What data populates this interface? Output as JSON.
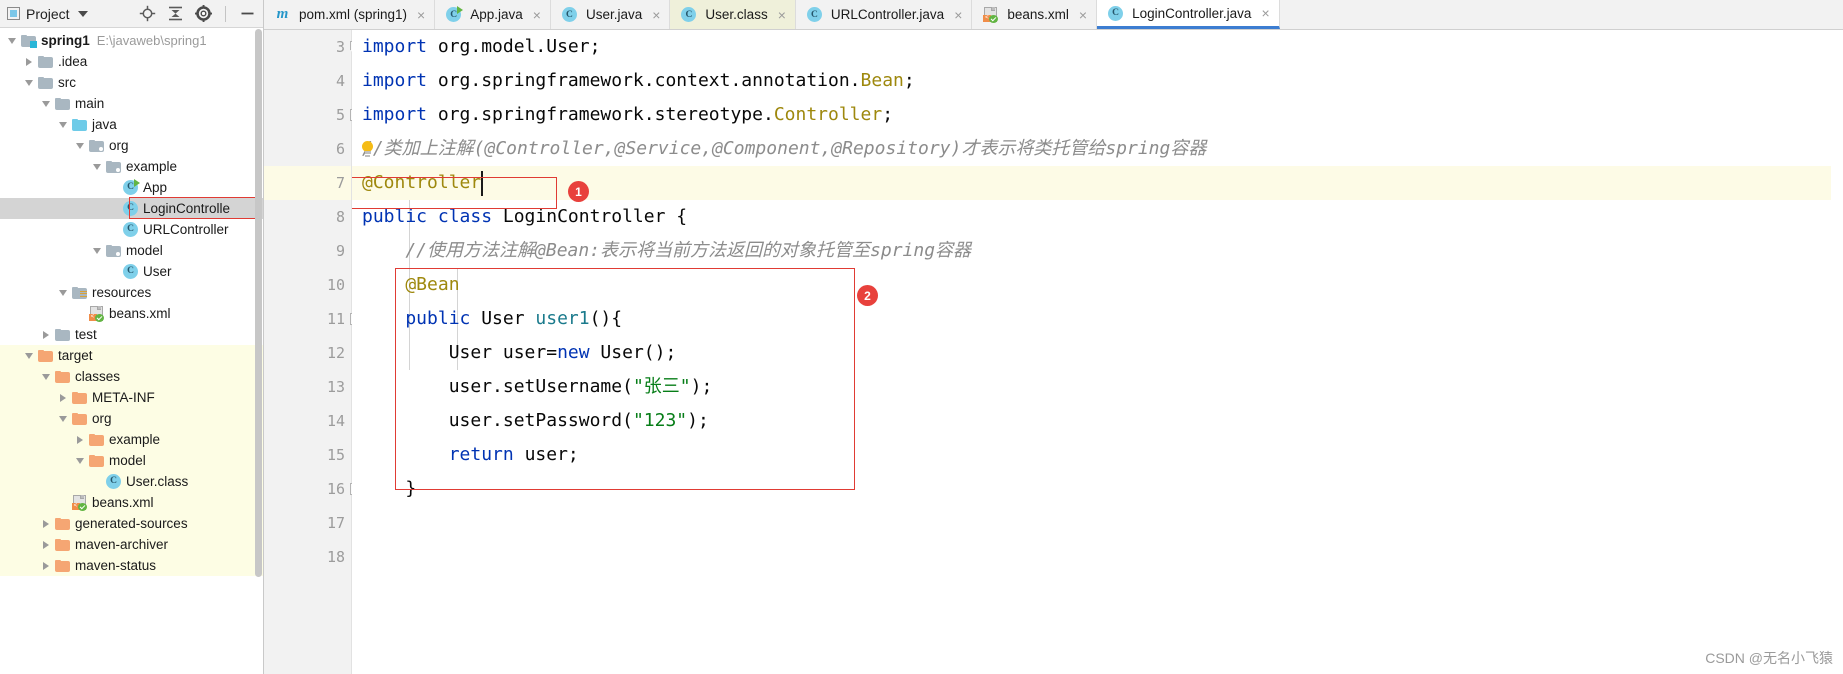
{
  "app": "IntelliJ IDEA",
  "project_panel": {
    "title": "Project",
    "title_icon": "project-window-icon",
    "chevron": "chevron-down-icon",
    "toolbar_icons": [
      {
        "name": "locate-target-icon"
      },
      {
        "name": "collapse-all-icon"
      },
      {
        "name": "settings-gear-icon"
      },
      {
        "name": "hide-panel-icon"
      }
    ],
    "tree": [
      {
        "label": "spring1",
        "path": "E:\\javaweb\\spring1",
        "icon": "module-folder-icon",
        "depth": 0,
        "twisty": "expanded",
        "bold": true,
        "state": "normal"
      },
      {
        "label": ".idea",
        "icon": "folder-icon",
        "depth": 1,
        "twisty": "collapsed",
        "state": "normal"
      },
      {
        "label": "src",
        "icon": "folder-icon",
        "depth": 1,
        "twisty": "expanded",
        "state": "normal"
      },
      {
        "label": "main",
        "icon": "folder-icon",
        "depth": 2,
        "twisty": "expanded",
        "state": "normal"
      },
      {
        "label": "java",
        "icon": "source-folder-icon",
        "depth": 3,
        "twisty": "expanded",
        "state": "normal"
      },
      {
        "label": "org",
        "icon": "package-folder-icon",
        "depth": 4,
        "twisty": "expanded",
        "state": "normal"
      },
      {
        "label": "example",
        "icon": "package-folder-icon",
        "depth": 5,
        "twisty": "expanded",
        "state": "normal"
      },
      {
        "label": "App",
        "icon": "java-class-runnable-icon",
        "depth": 6,
        "twisty": "none",
        "state": "normal"
      },
      {
        "label": "LoginControlle",
        "icon": "java-class-icon",
        "depth": 6,
        "twisty": "none",
        "state": "selected"
      },
      {
        "label": "URLController",
        "icon": "java-class-icon",
        "depth": 6,
        "twisty": "none",
        "state": "normal"
      },
      {
        "label": "model",
        "icon": "package-folder-icon",
        "depth": 5,
        "twisty": "expanded",
        "state": "normal"
      },
      {
        "label": "User",
        "icon": "java-class-icon",
        "depth": 6,
        "twisty": "none",
        "state": "normal"
      },
      {
        "label": "resources",
        "icon": "resources-folder-icon",
        "depth": 3,
        "twisty": "expanded",
        "state": "normal"
      },
      {
        "label": "beans.xml",
        "icon": "spring-xml-icon",
        "depth": 4,
        "twisty": "none",
        "state": "normal"
      },
      {
        "label": "test",
        "icon": "folder-icon",
        "depth": 2,
        "twisty": "collapsed",
        "state": "normal"
      },
      {
        "label": "target",
        "icon": "folder-orange-icon",
        "depth": 1,
        "twisty": "expanded",
        "state": "target"
      },
      {
        "label": "classes",
        "icon": "folder-orange-icon",
        "depth": 2,
        "twisty": "expanded",
        "state": "target"
      },
      {
        "label": "META-INF",
        "icon": "folder-orange-icon",
        "depth": 3,
        "twisty": "collapsed",
        "state": "target"
      },
      {
        "label": "org",
        "icon": "folder-orange-icon",
        "depth": 3,
        "twisty": "expanded",
        "state": "target"
      },
      {
        "label": "example",
        "icon": "folder-orange-icon",
        "depth": 4,
        "twisty": "collapsed",
        "state": "target"
      },
      {
        "label": "model",
        "icon": "folder-orange-icon",
        "depth": 4,
        "twisty": "expanded",
        "state": "target"
      },
      {
        "label": "User.class",
        "icon": "java-class-icon",
        "depth": 5,
        "twisty": "none",
        "state": "target"
      },
      {
        "label": "beans.xml",
        "icon": "spring-xml-icon",
        "depth": 3,
        "twisty": "none",
        "state": "target"
      },
      {
        "label": "generated-sources",
        "icon": "folder-orange-icon",
        "depth": 2,
        "twisty": "collapsed",
        "state": "target"
      },
      {
        "label": "maven-archiver",
        "icon": "folder-orange-icon",
        "depth": 2,
        "twisty": "collapsed",
        "state": "target"
      },
      {
        "label": "maven-status",
        "icon": "folder-orange-icon",
        "depth": 2,
        "twisty": "collapsed",
        "state": "target"
      }
    ],
    "highlight_box_on": "LoginControlle"
  },
  "tabs": [
    {
      "label": "pom.xml (spring1)",
      "icon": "maven-m-icon",
      "state": "normal",
      "closable": true
    },
    {
      "label": "App.java",
      "icon": "java-class-runnable-icon",
      "state": "normal",
      "closable": true
    },
    {
      "label": "User.java",
      "icon": "java-class-icon",
      "state": "normal",
      "closable": true
    },
    {
      "label": "User.class",
      "icon": "java-class-icon",
      "state": "class-file",
      "closable": true
    },
    {
      "label": "URLController.java",
      "icon": "java-class-icon",
      "state": "normal",
      "closable": true
    },
    {
      "label": "beans.xml",
      "icon": "spring-xml-icon",
      "state": "normal",
      "closable": true
    },
    {
      "label": "LoginController.java",
      "icon": "java-class-icon",
      "state": "active",
      "closable": true
    }
  ],
  "editor": {
    "close_glyph": "×",
    "first_visible_line": 3,
    "lines": [
      {
        "num": "3",
        "fold": "fold-end-top",
        "highlight": false,
        "segments": [
          {
            "t": "import",
            "c": "kw"
          },
          {
            "t": " org.model.User;",
            "c": "plain"
          }
        ]
      },
      {
        "num": "4",
        "fold": "none",
        "highlight": false,
        "segments": [
          {
            "t": "import",
            "c": "kw"
          },
          {
            "t": " org.springframework.context.annotation.",
            "c": "plain"
          },
          {
            "t": "Bean",
            "c": "ann"
          },
          {
            "t": ";",
            "c": "plain"
          }
        ]
      },
      {
        "num": "5",
        "fold": "fold-end-bottom",
        "highlight": false,
        "segments": [
          {
            "t": "import",
            "c": "kw"
          },
          {
            "t": " org.springframework.stereotype.",
            "c": "plain"
          },
          {
            "t": "Controller",
            "c": "ann"
          },
          {
            "t": ";",
            "c": "plain"
          }
        ]
      },
      {
        "num": "6",
        "fold": "none",
        "highlight": false,
        "bulb": true,
        "segments": [
          {
            "t": "//类加上注解(@Controller,@Service,@Component,@Repository)才表示将类托管给spring容器",
            "c": "cmt"
          }
        ]
      },
      {
        "num": "7",
        "fold": "none",
        "highlight": true,
        "caret": true,
        "segments": [
          {
            "t": "@Controller",
            "c": "ann"
          }
        ]
      },
      {
        "num": "8",
        "fold": "none",
        "highlight": false,
        "segments": [
          {
            "t": "public class",
            "c": "kw"
          },
          {
            "t": " LoginController {",
            "c": "plain"
          }
        ]
      },
      {
        "num": "9",
        "fold": "none",
        "highlight": false,
        "segments": [
          {
            "t": "    //使用方法注解@Bean:表示将当前方法返回的对象托管至spring容器",
            "c": "cmt"
          }
        ]
      },
      {
        "num": "10",
        "fold": "none",
        "highlight": false,
        "bean_icon": true,
        "segments": [
          {
            "t": "    @Bean",
            "c": "ann"
          }
        ]
      },
      {
        "num": "11",
        "fold": "fold-method",
        "highlight": false,
        "segments": [
          {
            "t": "    public",
            "c": "kw"
          },
          {
            "t": " User ",
            "c": "plain"
          },
          {
            "t": "user1",
            "c": "mth"
          },
          {
            "t": "(){",
            "c": "plain"
          }
        ]
      },
      {
        "num": "12",
        "fold": "none",
        "highlight": false,
        "segments": [
          {
            "t": "        User user=",
            "c": "plain"
          },
          {
            "t": "new",
            "c": "kw"
          },
          {
            "t": " User();",
            "c": "plain"
          }
        ]
      },
      {
        "num": "13",
        "fold": "none",
        "highlight": false,
        "segments": [
          {
            "t": "        user.setUsername(",
            "c": "plain"
          },
          {
            "t": "\"张三\"",
            "c": "str"
          },
          {
            "t": ");",
            "c": "plain"
          }
        ]
      },
      {
        "num": "14",
        "fold": "none",
        "highlight": false,
        "segments": [
          {
            "t": "        user.setPassword(",
            "c": "plain"
          },
          {
            "t": "\"123\"",
            "c": "str"
          },
          {
            "t": ");",
            "c": "plain"
          }
        ]
      },
      {
        "num": "15",
        "fold": "none",
        "highlight": false,
        "segments": [
          {
            "t": "        ",
            "c": "plain"
          },
          {
            "t": "return",
            "c": "kw"
          },
          {
            "t": " user;",
            "c": "plain"
          }
        ]
      },
      {
        "num": "16",
        "fold": "fold-method-end",
        "highlight": false,
        "segments": [
          {
            "t": "    }",
            "c": "plain"
          }
        ]
      },
      {
        "num": "17",
        "fold": "none",
        "highlight": false,
        "segments": [
          {
            "t": "",
            "c": "plain"
          }
        ]
      },
      {
        "num": "18",
        "fold": "none",
        "highlight": false,
        "segments": [
          {
            "t": "",
            "c": "plain"
          }
        ]
      }
    ],
    "annotations": [
      {
        "label": "1",
        "name": "annotation-badge-1"
      },
      {
        "label": "2",
        "name": "annotation-badge-2"
      }
    ]
  },
  "watermark": "CSDN @无名小飞猿",
  "colors": {
    "accent_blue": "#3c7dd1",
    "badge_red": "#e8413c",
    "highlight_box": "#e03b34",
    "keyword": "#0033b3",
    "annotation": "#9e880d",
    "string": "#067d17",
    "comment": "#8c8c8c",
    "method": "#1a7a8c",
    "caret_line_bg": "#fdfbe6",
    "target_folder_bg": "#fdfde4",
    "tree_selection_bg": "#d4d4d4"
  }
}
